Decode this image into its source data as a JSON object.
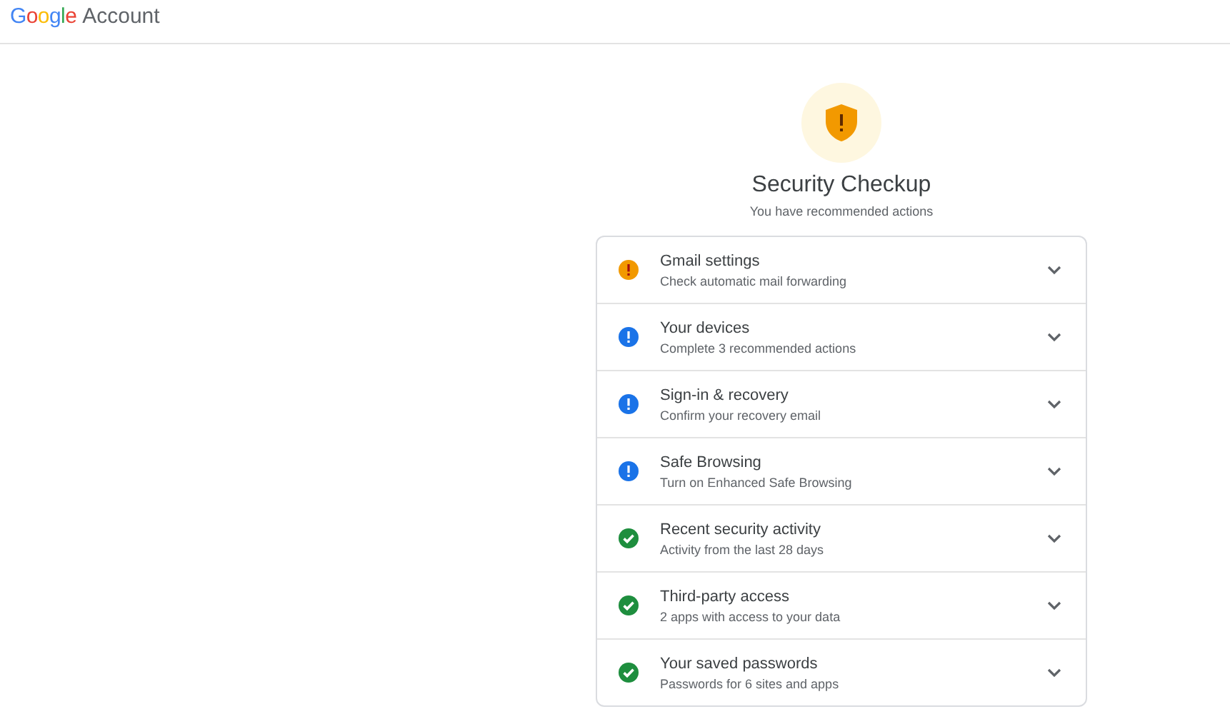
{
  "header": {
    "logo": "Google",
    "product": "Account"
  },
  "checkup": {
    "title": "Security Checkup",
    "subtitle": "You have recommended actions",
    "kind": "warning"
  },
  "items": [
    {
      "title": "Gmail settings",
      "subtitle": "Check automatic mail forwarding",
      "kind": "warning"
    },
    {
      "title": "Your devices",
      "subtitle": "Complete 3 recommended actions",
      "kind": "info"
    },
    {
      "title": "Sign-in & recovery",
      "subtitle": "Confirm your recovery email",
      "kind": "info"
    },
    {
      "title": "Safe Browsing",
      "subtitle": "Turn on Enhanced Safe Browsing",
      "kind": "info"
    },
    {
      "title": "Recent security activity",
      "subtitle": "Activity from the last 28 days",
      "kind": "ok"
    },
    {
      "title": "Third-party access",
      "subtitle": "2 apps with access to your data",
      "kind": "ok"
    },
    {
      "title": "Your saved passwords",
      "subtitle": "Passwords for 6 sites and apps",
      "kind": "ok"
    }
  ]
}
